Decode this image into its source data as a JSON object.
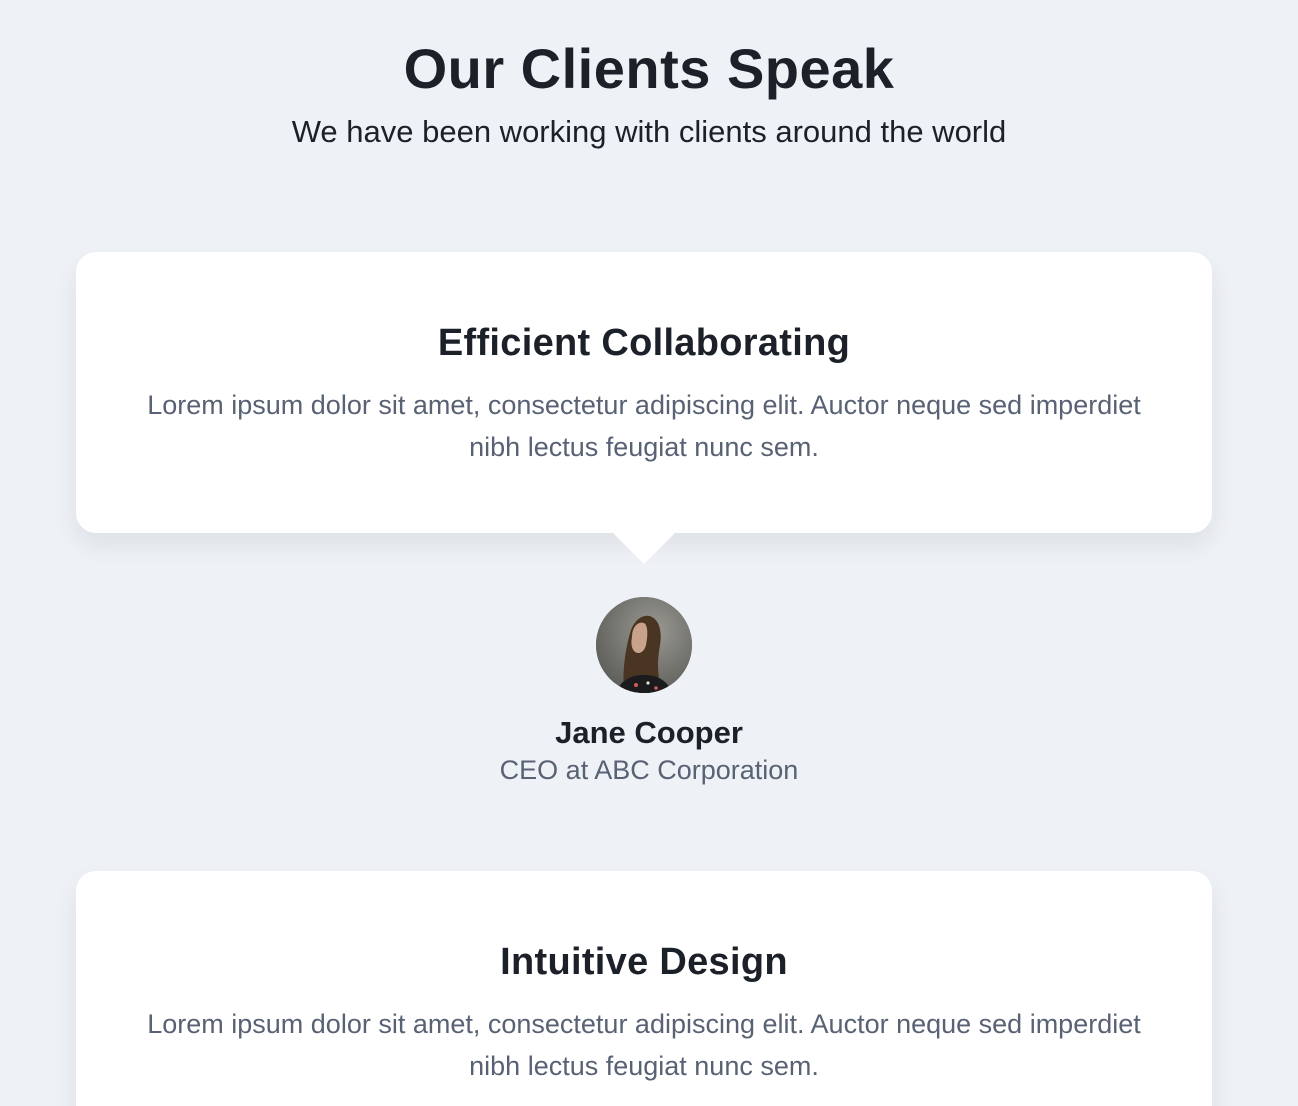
{
  "header": {
    "title": "Our Clients Speak",
    "subtitle": "We have been working with clients around the world"
  },
  "testimonials": [
    {
      "title": "Efficient Collaborating",
      "text": "Lorem ipsum dolor sit amet, consectetur adipiscing elit. Auctor neque sed imperdiet nibh lectus feugiat nunc sem.",
      "name": "Jane Cooper",
      "role": "CEO at ABC Corporation",
      "avatar_icon": "person-photo"
    },
    {
      "title": "Intuitive Design",
      "text": "Lorem ipsum dolor sit amet, consectetur adipiscing elit. Auctor neque sed imperdiet nibh lectus feugiat nunc sem."
    }
  ],
  "colors": {
    "background": "#eef1f6",
    "card": "#ffffff",
    "heading": "#1c2029",
    "muted": "#596274"
  }
}
